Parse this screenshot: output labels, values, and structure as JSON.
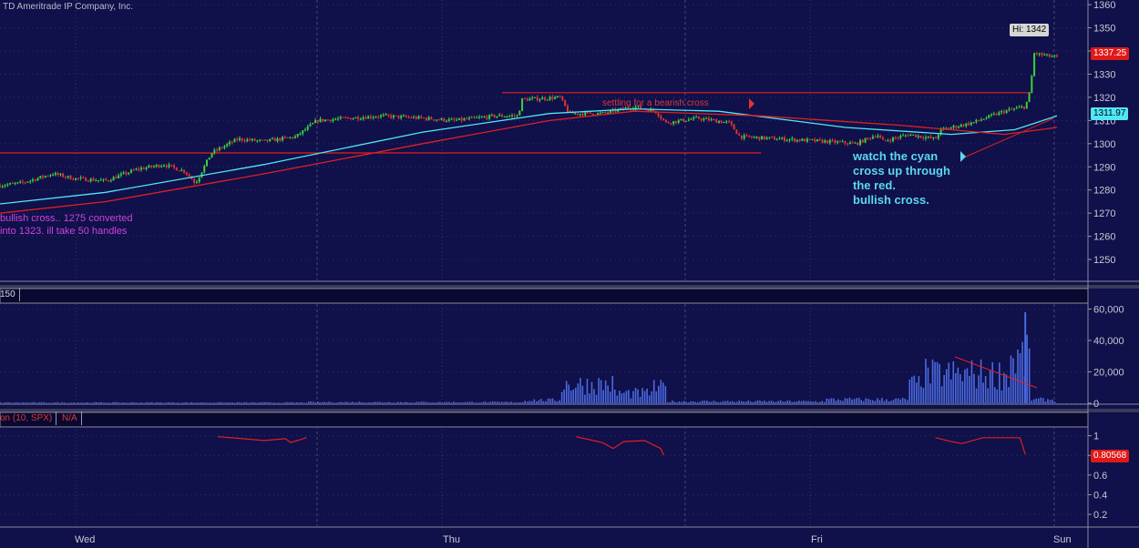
{
  "header": {
    "copyright": "TD Ameritrade IP Company, Inc."
  },
  "annotations": {
    "left": "bullish cross.. 1275  converted\ninto 1323. ill take 50 handles",
    "right": "watch the cyan\ncross up through\nthe red.\nbullish cross.",
    "middle": "settling for a bearish cross"
  },
  "panels": {
    "volume_title": "150",
    "correlation_title": "on (10, SPX)",
    "correlation_value": "N/A"
  },
  "tags": {
    "hi": "Hi: 1342",
    "last": "1337.25",
    "ma": "1311.97",
    "corr": "0.80568"
  },
  "colors": {
    "background": "#10104a",
    "grid": "#4a4a72",
    "up": "#3ad23a",
    "down": "#e03434",
    "fast_ma": "#4fe8f4",
    "slow_ma": "#e02020",
    "volume": "#4a6ae0",
    "correlation": "#e02020"
  },
  "chart_data": [
    {
      "type": "candlestick",
      "title": "",
      "x_labels": [
        "Wed",
        "Thu",
        "Fri",
        "Sun"
      ],
      "y_ticks": [
        1250,
        1260,
        1270,
        1280,
        1290,
        1300,
        1310,
        1320,
        1330,
        1340,
        1350,
        1360
      ],
      "ylim": [
        1241,
        1362
      ],
      "grid": true,
      "price_path": [
        [
          0.0,
          1282
        ],
        [
          0.02,
          1283
        ],
        [
          0.05,
          1287
        ],
        [
          0.07,
          1285
        ],
        [
          0.1,
          1284
        ],
        [
          0.13,
          1289
        ],
        [
          0.155,
          1291
        ],
        [
          0.175,
          1288
        ],
        [
          0.185,
          1283
        ],
        [
          0.2,
          1296
        ],
        [
          0.225,
          1302
        ],
        [
          0.25,
          1301
        ],
        [
          0.28,
          1303
        ],
        [
          0.3,
          1310
        ],
        [
          0.33,
          1311
        ],
        [
          0.36,
          1312
        ],
        [
          0.4,
          1311
        ],
        [
          0.43,
          1310
        ],
        [
          0.47,
          1312
        ],
        [
          0.49,
          1312
        ],
        [
          0.494,
          1319
        ],
        [
          0.53,
          1320
        ],
        [
          0.538,
          1313
        ],
        [
          0.57,
          1313
        ],
        [
          0.6,
          1316
        ],
        [
          0.62,
          1314
        ],
        [
          0.63,
          1309
        ],
        [
          0.66,
          1311
        ],
        [
          0.69,
          1309
        ],
        [
          0.7,
          1303
        ],
        [
          0.74,
          1302
        ],
        [
          0.78,
          1301
        ],
        [
          0.81,
          1300
        ],
        [
          0.83,
          1304
        ],
        [
          0.835,
          1301
        ],
        [
          0.86,
          1304
        ],
        [
          0.885,
          1302
        ],
        [
          0.89,
          1306
        ],
        [
          0.92,
          1309
        ],
        [
          0.95,
          1314
        ],
        [
          0.97,
          1316
        ],
        [
          0.975,
          1323
        ],
        [
          0.978,
          1339
        ],
        [
          0.99,
          1338
        ],
        [
          1.0,
          1337.25
        ]
      ],
      "lines": [
        {
          "name": "",
          "color": "fast_ma",
          "points": [
            [
              0.0,
              1274
            ],
            [
              0.1,
              1279
            ],
            [
              0.25,
              1291
            ],
            [
              0.4,
              1305
            ],
            [
              0.52,
              1313
            ],
            [
              0.6,
              1315
            ],
            [
              0.68,
              1314
            ],
            [
              0.8,
              1307
            ],
            [
              0.9,
              1304
            ],
            [
              0.96,
              1306
            ],
            [
              1.0,
              1311.97
            ]
          ]
        },
        {
          "name": "",
          "color": "slow_ma",
          "points": [
            [
              0.0,
              1270
            ],
            [
              0.1,
              1275
            ],
            [
              0.25,
              1287
            ],
            [
              0.4,
              1300
            ],
            [
              0.52,
              1310
            ],
            [
              0.6,
              1314
            ],
            [
              0.72,
              1312
            ],
            [
              0.85,
              1308
            ],
            [
              0.95,
              1304
            ],
            [
              1.0,
              1307
            ]
          ]
        }
      ],
      "ref_lines": [
        {
          "y": 1296,
          "x": [
            0.0,
            0.72
          ],
          "color": "slow_ma"
        },
        {
          "y": 1322,
          "x": [
            0.475,
            0.975
          ],
          "color": "slow_ma"
        }
      ]
    },
    {
      "type": "bar",
      "title": "",
      "y_ticks": [
        0,
        20000,
        40000,
        60000
      ],
      "ylim": [
        0,
        62000
      ],
      "clusters": [
        {
          "from": 0.0,
          "to": 0.29,
          "level": 600
        },
        {
          "from": 0.29,
          "to": 0.495,
          "level": 900
        },
        {
          "from": 0.495,
          "to": 0.53,
          "level": 2500
        },
        {
          "from": 0.53,
          "to": 0.58,
          "level": 15000
        },
        {
          "from": 0.58,
          "to": 0.615,
          "level": 8000
        },
        {
          "from": 0.615,
          "to": 0.63,
          "level": 12000
        },
        {
          "from": 0.63,
          "to": 0.78,
          "level": 1500
        },
        {
          "from": 0.78,
          "to": 0.86,
          "level": 3000
        },
        {
          "from": 0.86,
          "to": 0.87,
          "level": 15000
        },
        {
          "from": 0.87,
          "to": 0.955,
          "level": 23000
        },
        {
          "from": 0.955,
          "to": 0.975,
          "level": 35000
        },
        {
          "from": 0.975,
          "to": 1.0,
          "level": 3000
        }
      ],
      "spike": {
        "x": 0.97,
        "value": 58000
      }
    },
    {
      "type": "line",
      "title": "",
      "y_ticks": [
        0.2,
        0.4,
        0.6,
        0.8,
        1
      ],
      "ylim": [
        0.08,
        1.08
      ],
      "segments": [
        [
          [
            0.206,
            0.99
          ],
          [
            0.23,
            0.97
          ],
          [
            0.25,
            0.95
          ],
          [
            0.27,
            0.97
          ],
          [
            0.275,
            0.93
          ],
          [
            0.29,
            0.98
          ]
        ],
        [
          [
            0.545,
            0.99
          ],
          [
            0.57,
            0.93
          ],
          [
            0.58,
            0.87
          ],
          [
            0.59,
            0.94
          ],
          [
            0.61,
            0.95
          ],
          [
            0.625,
            0.87
          ],
          [
            0.628,
            0.8
          ]
        ],
        [
          [
            0.885,
            0.98
          ],
          [
            0.9,
            0.94
          ],
          [
            0.91,
            0.92
          ],
          [
            0.93,
            0.98
          ],
          [
            0.965,
            0.98
          ],
          [
            0.97,
            0.81
          ]
        ]
      ]
    }
  ]
}
